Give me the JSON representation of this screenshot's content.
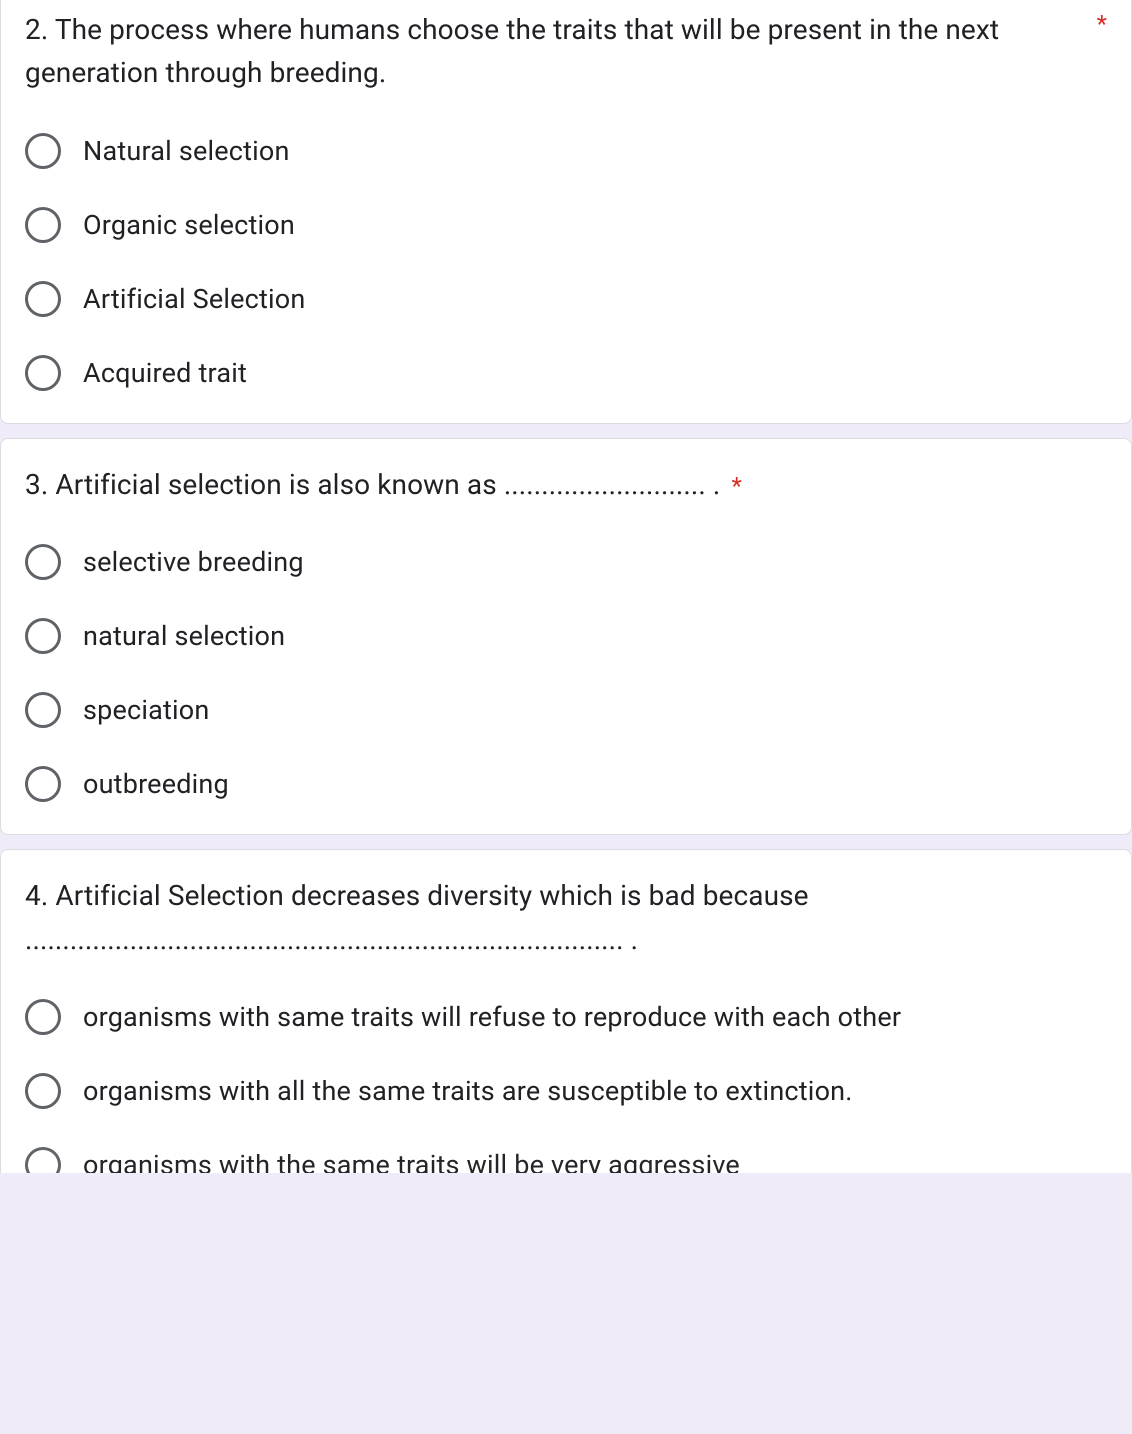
{
  "questions": [
    {
      "text": "2. The process where humans choose the traits that will be present in the next generation through breeding.",
      "required": true,
      "asterisk": "*",
      "options": [
        "Natural selection",
        "Organic selection",
        "Artificial Selection",
        "Acquired trait"
      ]
    },
    {
      "text": "3. Artificial selection is also known as ........................... .",
      "required": true,
      "asterisk": "*",
      "options": [
        "selective breeding",
        "natural selection",
        "speciation",
        "outbreeding"
      ]
    },
    {
      "text": "4. Artificial Selection decreases diversity which is bad because ................................................................................ .",
      "required": false,
      "asterisk": "",
      "options": [
        "organisms with same traits will refuse to reproduce with each other",
        "organisms with all the same traits are susceptible to extinction.",
        "organisms with the same traits will be very aggressive"
      ]
    }
  ]
}
